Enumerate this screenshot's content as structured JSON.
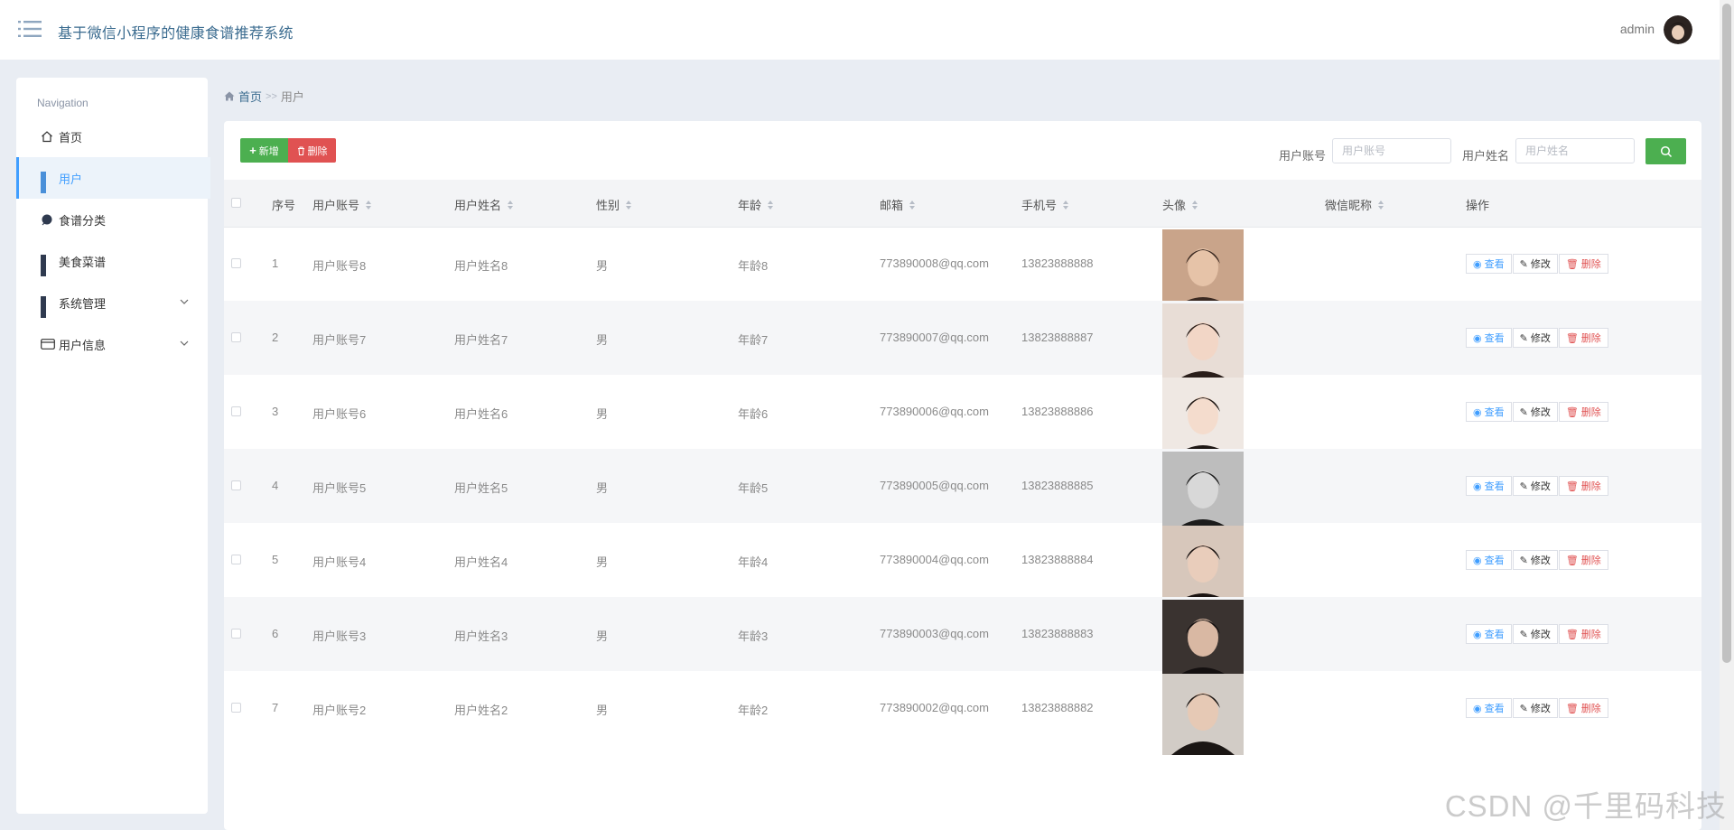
{
  "header": {
    "title": "基于微信小程序的健康食谱推荐系统",
    "username": "admin"
  },
  "sidebar": {
    "caption": "Navigation",
    "items": [
      {
        "label": "首页",
        "icon": "home-icon"
      },
      {
        "label": "用户",
        "icon": "grid-icon"
      },
      {
        "label": "食谱分类",
        "icon": "drop-icon"
      },
      {
        "label": "美食菜谱",
        "icon": "grid-icon"
      },
      {
        "label": "系统管理",
        "icon": "grid-icon"
      },
      {
        "label": "用户信息",
        "icon": "card-icon"
      }
    ]
  },
  "breadcrumb": {
    "home": "首页",
    "separator": ">>",
    "current": "用户"
  },
  "toolbar": {
    "add_label": "新增",
    "delete_label": "删除",
    "search_account_label": "用户账号",
    "search_account_placeholder": "用户账号",
    "search_name_label": "用户姓名",
    "search_name_placeholder": "用户姓名"
  },
  "table": {
    "columns": [
      "序号",
      "用户账号",
      "用户姓名",
      "性别",
      "年龄",
      "邮箱",
      "手机号",
      "头像",
      "微信昵称",
      "操作"
    ],
    "actions": {
      "view": "查看",
      "edit": "修改",
      "delete": "删除"
    },
    "rows": [
      {
        "index": "1",
        "account": "用户账号8",
        "name": "用户姓名8",
        "gender": "男",
        "age": "年龄8",
        "email": "773890008@qq.com",
        "phone": "13823888888",
        "nickname": ""
      },
      {
        "index": "2",
        "account": "用户账号7",
        "name": "用户姓名7",
        "gender": "男",
        "age": "年龄7",
        "email": "773890007@qq.com",
        "phone": "13823888887",
        "nickname": ""
      },
      {
        "index": "3",
        "account": "用户账号6",
        "name": "用户姓名6",
        "gender": "男",
        "age": "年龄6",
        "email": "773890006@qq.com",
        "phone": "13823888886",
        "nickname": ""
      },
      {
        "index": "4",
        "account": "用户账号5",
        "name": "用户姓名5",
        "gender": "男",
        "age": "年龄5",
        "email": "773890005@qq.com",
        "phone": "13823888885",
        "nickname": ""
      },
      {
        "index": "5",
        "account": "用户账号4",
        "name": "用户姓名4",
        "gender": "男",
        "age": "年龄4",
        "email": "773890004@qq.com",
        "phone": "13823888884",
        "nickname": ""
      },
      {
        "index": "6",
        "account": "用户账号3",
        "name": "用户姓名3",
        "gender": "男",
        "age": "年龄3",
        "email": "773890003@qq.com",
        "phone": "13823888883",
        "nickname": ""
      },
      {
        "index": "7",
        "account": "用户账号2",
        "name": "用户姓名2",
        "gender": "男",
        "age": "年龄2",
        "email": "773890002@qq.com",
        "phone": "13823888882",
        "nickname": ""
      }
    ]
  },
  "watermark": "CSDN @千里码科技",
  "colors": {
    "primary": "#409eff",
    "success": "#4caf50",
    "danger": "#e05252",
    "title": "#3a6b8f",
    "background": "#e9edf3"
  }
}
